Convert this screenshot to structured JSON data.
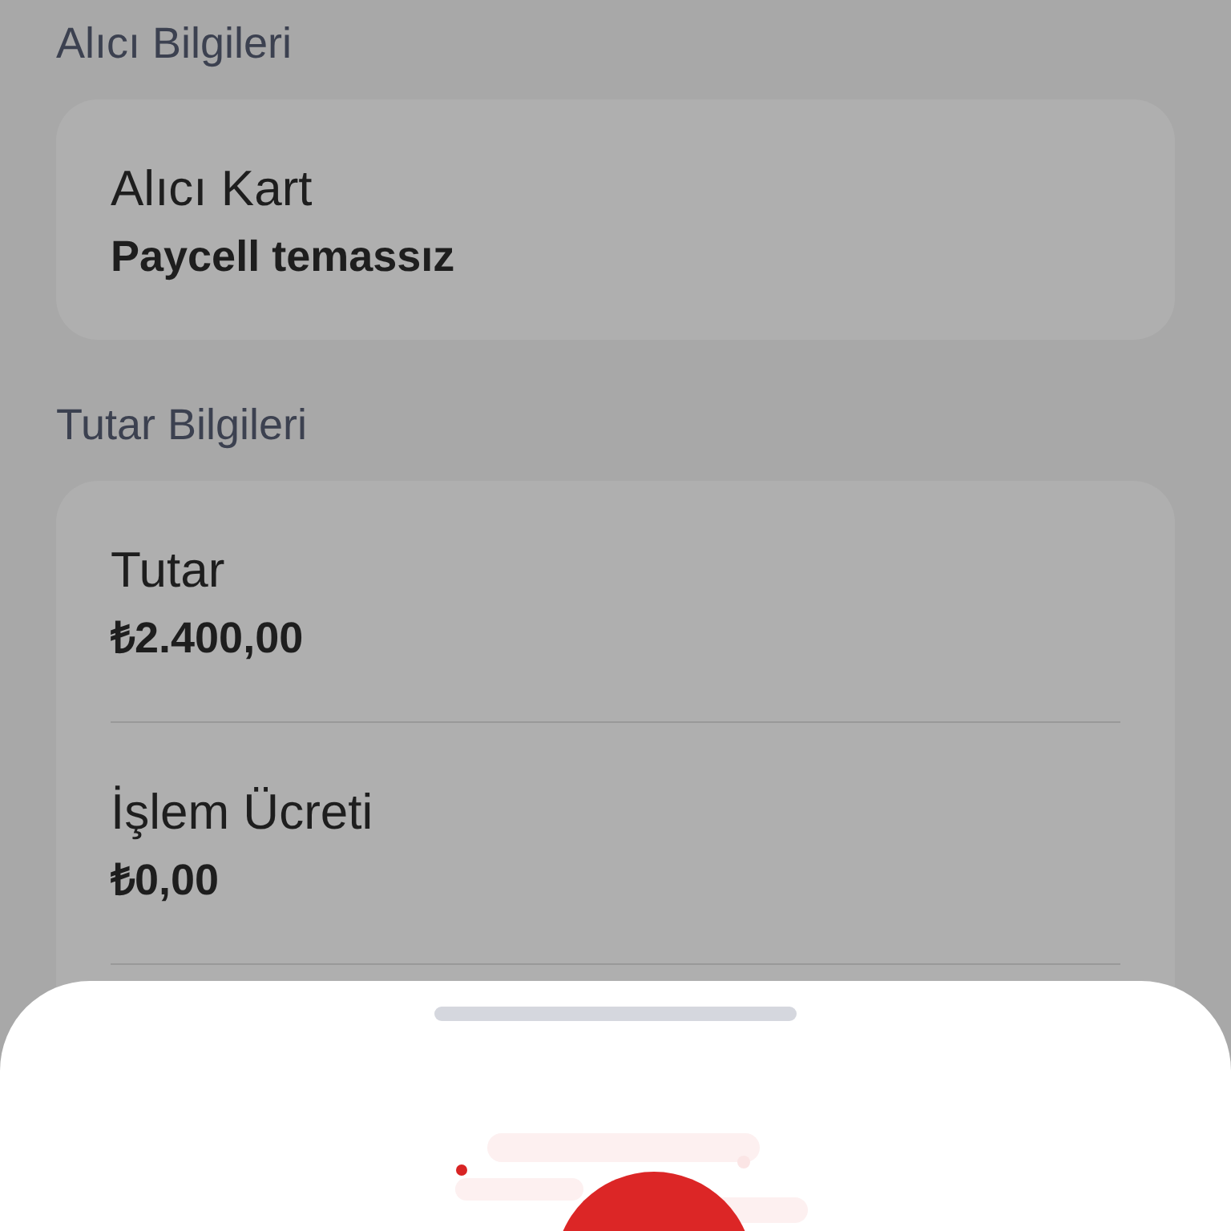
{
  "sections": [
    {
      "title": "Alıcı Bilgileri",
      "items": [
        {
          "label": "Alıcı Kart",
          "value": "Paycell temassız"
        }
      ]
    },
    {
      "title": "Tutar Bilgileri",
      "items": [
        {
          "label": "Tutar",
          "value": "₺2.400,00"
        },
        {
          "label": "İşlem Ücreti",
          "value": "₺0,00"
        }
      ]
    }
  ]
}
